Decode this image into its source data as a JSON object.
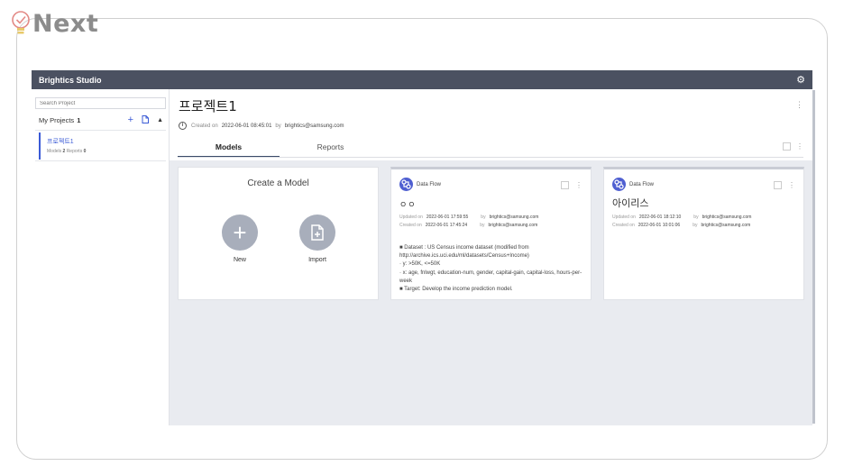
{
  "brand": {
    "text": "Next"
  },
  "app": {
    "title": "Brightics Studio",
    "settings_icon": "gear-icon"
  },
  "sidebar": {
    "search_placeholder": "Search Project",
    "my_projects_label": "My Projects",
    "my_projects_count": "1",
    "projects": [
      {
        "name": "프로젝트1",
        "models_label": "Models",
        "models_count": "2",
        "reports_label": "Reports",
        "reports_count": "0"
      }
    ]
  },
  "project": {
    "title": "프로젝트1",
    "created_label": "Created on",
    "created_value": "2022-06-01 08:45:01",
    "by_label": "by",
    "by_value": "brightics@samsung.com"
  },
  "tabs": [
    {
      "label": "Models",
      "active": true
    },
    {
      "label": "Reports",
      "active": false
    }
  ],
  "create": {
    "title": "Create a Model",
    "new_label": "New",
    "import_label": "Import"
  },
  "models": [
    {
      "type": "Data Flow",
      "title": "ㅇㅇ",
      "updated_label": "Updated on",
      "updated_value": "2022-06-01 17:59:55",
      "updated_by_label": "by",
      "updated_by": "brightics@samsung.com",
      "created_label": "Created on",
      "created_value": "2022-06-01 17:45:24",
      "created_by_label": "by",
      "created_by": "brightics@samsung.com",
      "description": [
        "■ Dataset : US Census income dataset (modified from http://archive.ics.uci.edu/ml/datasets/Census+Income)",
        "· y: >50K, <=50K",
        "· x: age, fnlwgt, education-num, gender, capital-gain, capital-loss, hours-per-week",
        "■ Target: Develop the income prediction model."
      ]
    },
    {
      "type": "Data Flow",
      "title": "아이리스",
      "updated_label": "Updated on",
      "updated_value": "2022-06-01 18:12:10",
      "updated_by_label": "by",
      "updated_by": "brightics@samsung.com",
      "created_label": "Created on",
      "created_value": "2022-06-01 10:01:06",
      "created_by_label": "by",
      "created_by": "brightics@samsung.com"
    }
  ],
  "colors": {
    "accent": "#3b5bd6",
    "topbar": "#4b5161",
    "dataflow_icon": "#4f5fd1",
    "panel_bg": "#e9ebf0"
  }
}
